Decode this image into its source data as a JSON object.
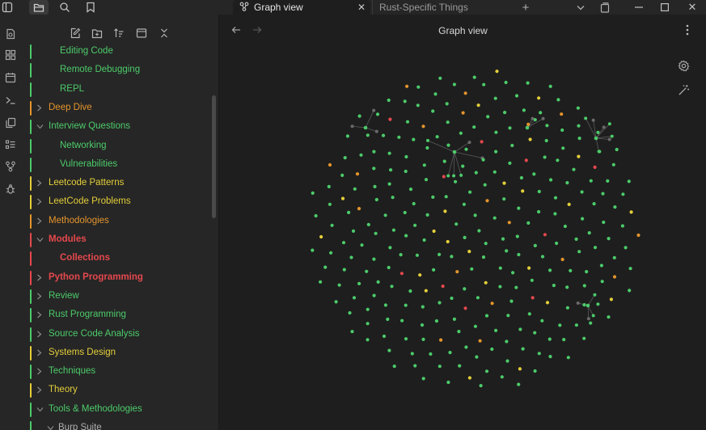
{
  "tabs": {
    "graph_title": "Graph view",
    "rust_title": "Rust-Specific Things"
  },
  "view": {
    "title": "Graph view"
  },
  "icons": {
    "sidebar_toggle": "sidebar-toggle-icon",
    "files": "folder-icon",
    "search": "search-icon",
    "bookmarks": "bookmark-icon",
    "new_tab": "plus-icon",
    "tab_list": "chevron-down-icon",
    "settings": "gear-icon",
    "animate": "magic-wand-icon"
  },
  "colors": {
    "green": "#4ccb6a",
    "orange": "#e5952c",
    "yellow": "#e4cf3a",
    "red": "#e5484d",
    "edge": "#5a5a5a"
  },
  "tree": [
    {
      "label": "Editing Code",
      "color": "green",
      "depth": 1
    },
    {
      "label": "Remote Debugging",
      "color": "green",
      "depth": 1
    },
    {
      "label": "REPL",
      "color": "green",
      "depth": 1
    },
    {
      "label": "Deep Dive",
      "color": "orange",
      "depth": 0,
      "collapsed": true
    },
    {
      "label": "Interview Questions",
      "color": "green",
      "depth": 0,
      "collapsed": false
    },
    {
      "label": "Networking",
      "color": "green",
      "depth": 1
    },
    {
      "label": "Vulnerabilities",
      "color": "green",
      "depth": 1
    },
    {
      "label": "Leetcode Patterns",
      "color": "yellow",
      "depth": 0,
      "collapsed": true
    },
    {
      "label": "LeetCode Problems",
      "color": "yellow",
      "depth": 0,
      "collapsed": true
    },
    {
      "label": "Methodologies",
      "color": "orange",
      "depth": 0,
      "collapsed": true
    },
    {
      "label": "Modules",
      "color": "red",
      "depth": 0,
      "collapsed": false,
      "bold": true
    },
    {
      "label": "Collections",
      "color": "red",
      "depth": 1,
      "bold": true
    },
    {
      "label": "Python Programming",
      "color": "red",
      "depth": 0,
      "collapsed": true,
      "bold": true
    },
    {
      "label": "Review",
      "color": "green",
      "depth": 0,
      "collapsed": true
    },
    {
      "label": "Rust Programming",
      "color": "green",
      "depth": 0,
      "collapsed": true
    },
    {
      "label": "Source Code Analysis",
      "color": "green",
      "depth": 0,
      "collapsed": true
    },
    {
      "label": "Systems Design",
      "color": "yellow",
      "depth": 0,
      "collapsed": true
    },
    {
      "label": "Techniques",
      "color": "green",
      "depth": 0,
      "collapsed": true
    },
    {
      "label": "Theory",
      "color": "yellow",
      "depth": 0,
      "collapsed": true
    },
    {
      "label": "Tools & Methodologies",
      "color": "green",
      "depth": 0,
      "collapsed": false
    },
    {
      "label": "Burp Suite",
      "color": "grey",
      "depth": 1,
      "collapsed": false
    }
  ]
}
